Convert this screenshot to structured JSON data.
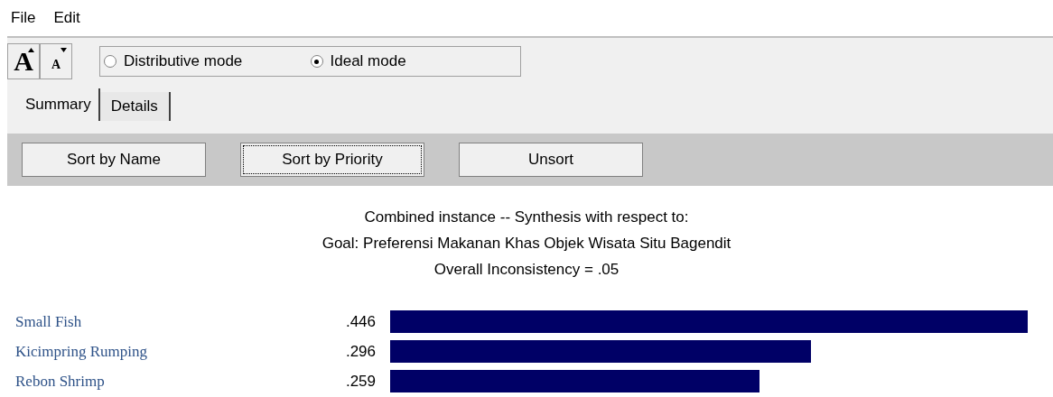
{
  "menu": [
    "File",
    "Edit"
  ],
  "font_buttons": [
    {
      "kind": "increase",
      "label": "A"
    },
    {
      "kind": "decrease",
      "label": "A"
    }
  ],
  "modes": [
    {
      "label": "Distributive mode",
      "selected": false
    },
    {
      "label": "Ideal mode",
      "selected": true
    }
  ],
  "tabs": [
    {
      "label": "Summary",
      "selected": true
    },
    {
      "label": "Details",
      "selected": false
    }
  ],
  "buttons": [
    {
      "label": "Sort by Name",
      "focused": false
    },
    {
      "label": "Sort by Priority",
      "focused": true
    },
    {
      "label": "Unsort",
      "focused": false
    }
  ],
  "header": [
    "Combined instance -- Synthesis with respect to:",
    "Goal: Preferensi Makanan Khas Objek Wisata Situ Bagendit",
    "Overall Inconsistency = .05"
  ],
  "results": [
    {
      "name": "Small Fish",
      "value": ".446",
      "level": 1
    },
    {
      "name": "Kicimpring Rumping",
      "value": ".296",
      "level": 0.66
    },
    {
      "name": "Rebon Shrimp",
      "value": ".259",
      "level": 0.58
    }
  ]
}
